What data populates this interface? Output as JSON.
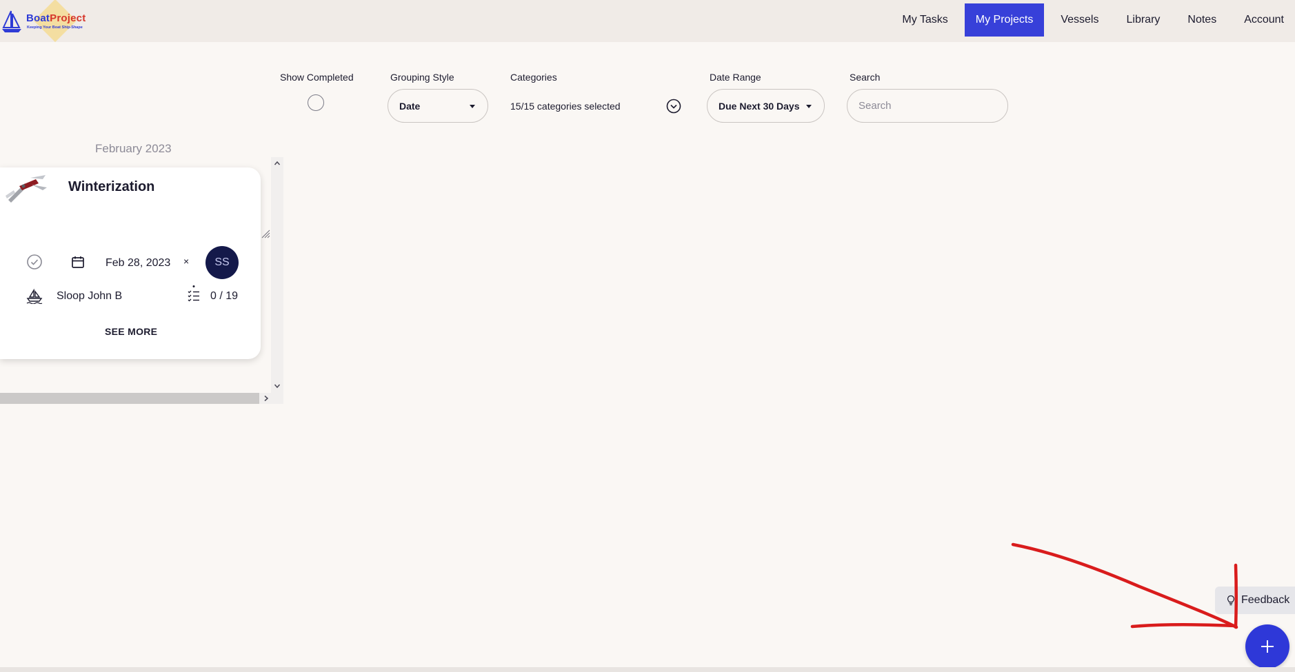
{
  "header": {
    "brand": {
      "part1": "Boat",
      "part2": "Project",
      "tagline": "Keeping Your Boat Ship-Shape"
    },
    "nav": [
      {
        "label": "My Tasks",
        "active": false
      },
      {
        "label": "My Projects",
        "active": true
      },
      {
        "label": "Vessels",
        "active": false
      },
      {
        "label": "Library",
        "active": false
      },
      {
        "label": "Notes",
        "active": false
      },
      {
        "label": "Account",
        "active": false
      }
    ]
  },
  "filters": {
    "show_completed": {
      "label": "Show Completed",
      "checked": false
    },
    "grouping_style": {
      "label": "Grouping Style",
      "value": "Date"
    },
    "categories": {
      "label": "Categories",
      "value": "15/15 categories selected"
    },
    "date_range": {
      "label": "Date Range",
      "value": "Due Next 30 Days"
    },
    "search": {
      "label": "Search",
      "placeholder": "Search",
      "value": ""
    }
  },
  "groups": [
    {
      "title": "February 2023",
      "projects": [
        {
          "title": "Winterization",
          "due_date": "Feb 28, 2023",
          "clear_symbol": "×",
          "assignee_initials": "SS",
          "vessel": "Sloop John B",
          "tasks_done": "0 / 19",
          "see_more": "SEE MORE",
          "image": "multitool-photo"
        }
      ]
    }
  ],
  "feedback": {
    "label": "Feedback"
  },
  "fab": {
    "icon": "plus-icon"
  },
  "colors": {
    "accent": "#3740d9",
    "fab": "#2e38d8",
    "avatar": "#14194a",
    "annotation": "#d91c1c"
  }
}
